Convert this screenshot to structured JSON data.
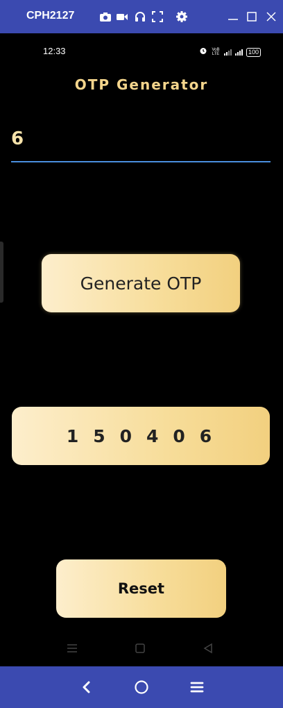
{
  "window": {
    "device_name": "CPH2127"
  },
  "status_bar": {
    "time": "12:33",
    "network": "VoB LTE",
    "battery": "100"
  },
  "app": {
    "title": "OTP Generator",
    "length_input_value": "6",
    "generate_button_label": "Generate OTP",
    "otp_value": "150406",
    "otp_display": "1 5 0 4 0 6",
    "reset_button_label": "Reset"
  },
  "colors": {
    "window_bar": "#3b4ab0",
    "background": "#000000",
    "title": "#f4d58c",
    "input_underline": "#4a8fdf",
    "gold_light": "#fdeecc",
    "gold_dark": "#f2d07f"
  },
  "icons": {
    "titlebar": [
      "camera-icon",
      "video-icon",
      "headphones-icon",
      "fullscreen-icon",
      "settings-icon",
      "minimize-icon",
      "maximize-icon",
      "close-icon"
    ],
    "android_nav": [
      "recents-icon",
      "home-icon",
      "back-icon"
    ],
    "bottom_bar": [
      "back-icon",
      "home-icon",
      "menu-icon"
    ]
  }
}
